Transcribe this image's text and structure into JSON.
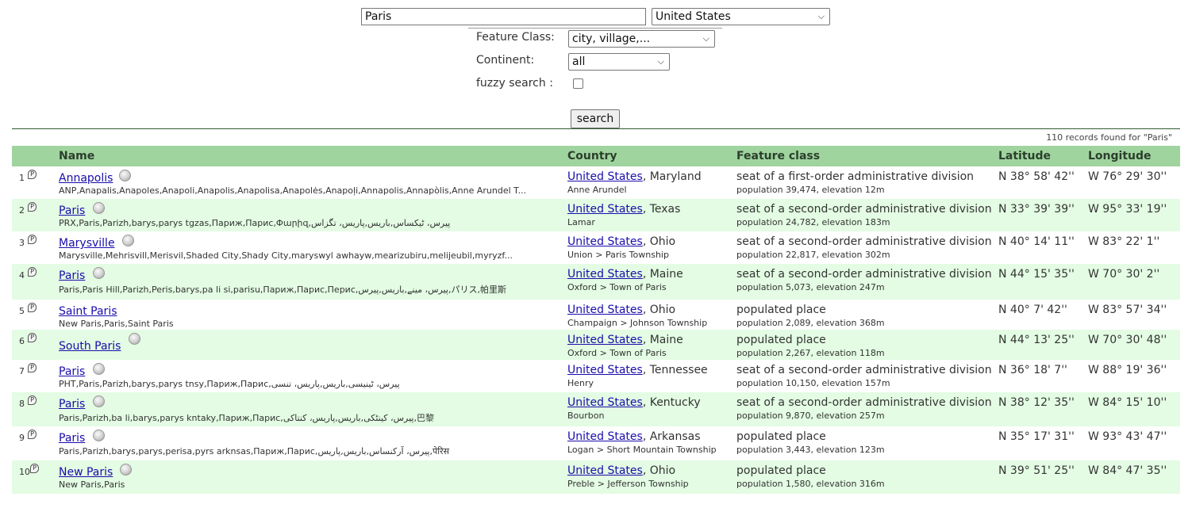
{
  "search": {
    "query": "Paris",
    "country": "United States",
    "feature_class_label": "Feature Class:",
    "feature_class_value": "city, village,...",
    "continent_label": "Continent:",
    "continent_value": "all",
    "fuzzy_label": "fuzzy search :",
    "fuzzy_checked": false,
    "button_label": "search"
  },
  "records_text": "110 records found for \"Paris\"",
  "table": {
    "headers": [
      "Name",
      "Country",
      "Feature class",
      "Latitude",
      "Longitude"
    ],
    "rows": [
      {
        "num": "1",
        "name": "Annapolis",
        "alt": "ANP,Anapalis,Anapoles,Anapoli,Anapolis,Anapolisa,Anapolės,Anapoļi,Annapolis,Annapòlis,Anne Arundel T...",
        "country": "United States",
        "state": ", Maryland",
        "admin": "Anne Arundel",
        "fclass": "seat of a first-order administrative division",
        "pop": "population 39,474, elevation 12m",
        "lat": "N 38° 58' 42''",
        "lon": "W 76° 29' 30''"
      },
      {
        "num": "2",
        "name": "Paris",
        "alt": "PRX,Paris,Parizh,barys,parys tgzas,Париж,Парис,Փարիզ,پیرس، ٹیکساس,باریس,پاریس، تگزاس",
        "country": "United States",
        "state": ", Texas",
        "admin": "Lamar",
        "fclass": "seat of a second-order administrative division",
        "pop": "population 24,782, elevation 183m",
        "lat": "N 33° 39' 39''",
        "lon": "W 95° 33' 19''"
      },
      {
        "num": "3",
        "name": "Marysville",
        "alt": "Marysville,Mehrisvill,Merisvil,Shaded City,Shady City,maryswyl awhayw,mearizubiru,melijeubil,myryzf...",
        "country": "United States",
        "state": ", Ohio",
        "admin": "Union > Paris Township",
        "fclass": "seat of a second-order administrative division",
        "pop": "population 22,817, elevation 302m",
        "lat": "N 40° 14' 11''",
        "lon": "W 83° 22' 1''"
      },
      {
        "num": "4",
        "name": "Paris",
        "alt": "Paris,Paris Hill,Parizh,Peris,barys,pa li si,parisu,Париж,Парис,Перис,پیرس، مینے,باریس,پیرس,パリス,帕里斯",
        "country": "United States",
        "state": ", Maine",
        "admin": "Oxford > Town of Paris",
        "fclass": "seat of a second-order administrative division",
        "pop": "population 5,073, elevation 247m",
        "lat": "N 44° 15' 35''",
        "lon": "W 70° 30' 2''"
      },
      {
        "num": "5",
        "name": "Saint Paris",
        "alt": "New Paris,Paris,Saint Paris",
        "country": "United States",
        "state": ", Ohio",
        "admin": "Champaign > Johnson Township",
        "fclass": "populated place",
        "pop": "population 2,089, elevation 368m",
        "lat": "N 40° 7' 42''",
        "lon": "W 83° 57' 34''"
      },
      {
        "num": "6",
        "name": "South Paris",
        "alt": "",
        "country": "United States",
        "state": ", Maine",
        "admin": "Oxford > Town of Paris",
        "fclass": "populated place",
        "pop": "population 2,267, elevation 118m",
        "lat": "N 44° 13' 25''",
        "lon": "W 70° 30' 48''"
      },
      {
        "num": "7",
        "name": "Paris",
        "alt": "PHT,Paris,Parizh,barys,parys tnsy,Париж,Парис,پیرس، ٹینیسی,باریس,پاریس، تنسی",
        "country": "United States",
        "state": ", Tennessee",
        "admin": "Henry",
        "fclass": "seat of a second-order administrative division",
        "pop": "population 10,150, elevation 157m",
        "lat": "N 36° 18' 7''",
        "lon": "W 88° 19' 36''"
      },
      {
        "num": "8",
        "name": "Paris",
        "alt": "Paris,Parizh,ba li,barys,parys kntaky,Париж,Парис,پیرس، کینٹکی,باریس,پاریس، کنتاکی,巴黎",
        "country": "United States",
        "state": ", Kentucky",
        "admin": "Bourbon",
        "fclass": "seat of a second-order administrative division",
        "pop": "population 9,870, elevation 257m",
        "lat": "N 38° 12' 35''",
        "lon": "W 84° 15' 10''"
      },
      {
        "num": "9",
        "name": "Paris",
        "alt": "Paris,Parizh,barys,parys,perisa,pyrs arknsas,Париж,Парис,پیرس، آرکنساس,باریس,پاریس,पेरिस",
        "country": "United States",
        "state": ", Arkansas",
        "admin": "Logan > Short Mountain Township",
        "fclass": "populated place",
        "pop": "population 3,443, elevation 123m",
        "lat": "N 35° 17' 31''",
        "lon": "W 93° 43' 47''"
      },
      {
        "num": "10",
        "name": "New Paris",
        "alt": "New Paris,Paris",
        "country": "United States",
        "state": ", Ohio",
        "admin": "Preble > Jefferson Township",
        "fclass": "populated place",
        "pop": "population 1,580, elevation 316m",
        "lat": "N 39° 51' 25''",
        "lon": "W 84° 47' 35''"
      }
    ]
  },
  "colors": {
    "header_bg": "#9fd49f",
    "alt_row_bg": "#e3fce3",
    "link": "#1a0dab"
  },
  "icons": {
    "pin": "placemark-icon",
    "wiki": "wikipedia-globe-icon"
  }
}
